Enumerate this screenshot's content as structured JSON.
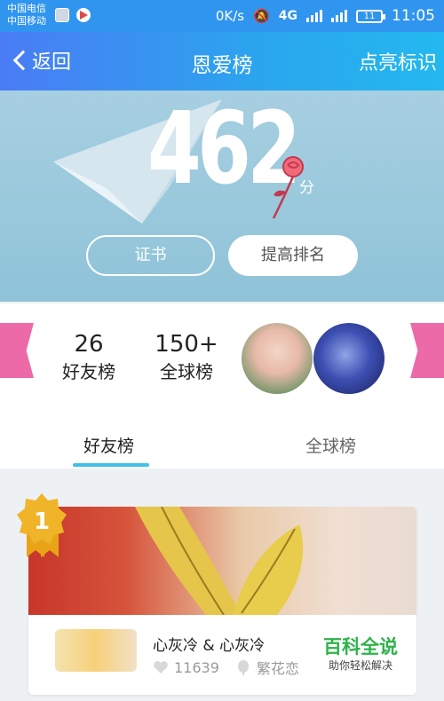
{
  "status_bar": {
    "carrier_1": "中国电信",
    "carrier_2": "中国移动",
    "speed": "0K/s",
    "network": "4G",
    "battery": "11",
    "time": "11:05"
  },
  "nav": {
    "back_label": "返回",
    "title": "恩爱榜",
    "action_label": "点亮标识"
  },
  "hero": {
    "score": "462",
    "unit": "分",
    "certificate_button": "证书",
    "improve_button": "提高排名"
  },
  "stats": {
    "friends_rank": "26",
    "friends_label": "好友榜",
    "global_rank": "150+",
    "global_label": "全球榜"
  },
  "tabs": [
    {
      "label": "好友榜",
      "active": true
    },
    {
      "label": "全球榜",
      "active": false
    }
  ],
  "ranking": {
    "rank_badge": "1",
    "name": "心灰冷 & 心灰冷",
    "likes": "11639",
    "location": "繁花恋"
  },
  "watermark": {
    "title": "百科全说",
    "subtitle": "助你轻松解决"
  },
  "colors": {
    "nav_start": "#4a7cf5",
    "nav_end": "#23b8ef",
    "hero_bg": "#9ccadd",
    "ribbon": "#ec6aa8",
    "tab_accent": "#3fc1e6",
    "badge_gold": "#f0b429"
  }
}
